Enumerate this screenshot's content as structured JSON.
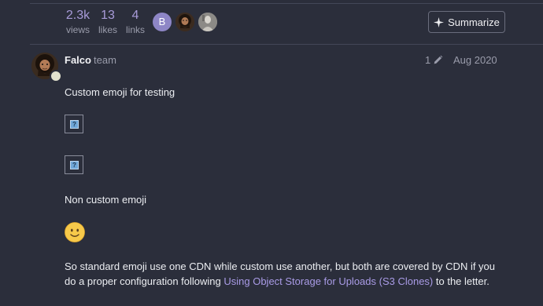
{
  "topic_stats": {
    "views": {
      "value": "2.3k",
      "label": "views"
    },
    "likes": {
      "value": "13",
      "label": "likes"
    },
    "links": {
      "value": "4",
      "label": "links"
    }
  },
  "participants": [
    {
      "initial": "B",
      "color": "#8e86c6"
    },
    {
      "initial": "",
      "color": "#4b3a2a"
    },
    {
      "initial": "",
      "color": "#8a8885"
    }
  ],
  "summarize_button": {
    "label": "Summarize",
    "icon": "sparkle-icon"
  },
  "post": {
    "author": "Falco",
    "role": "team",
    "edit_count": "1",
    "date": "Aug 2020",
    "paragraphs": {
      "custom_emoji": "Custom emoji for testing",
      "non_custom": "Non custom emoji",
      "body_before_link": "So standard emoji use one CDN while custom use another, but both are covered by CDN if you do a proper configuration following ",
      "link_text": "Using Object Storage for Uploads (S3 Clones)",
      "body_after_link": " to the letter."
    },
    "emoji": "slightly-smiling-face"
  },
  "colors": {
    "background": "#2b2e3b",
    "accent": "#a89bd9",
    "link": "#a99be6",
    "muted_text": "#9a9cab"
  }
}
